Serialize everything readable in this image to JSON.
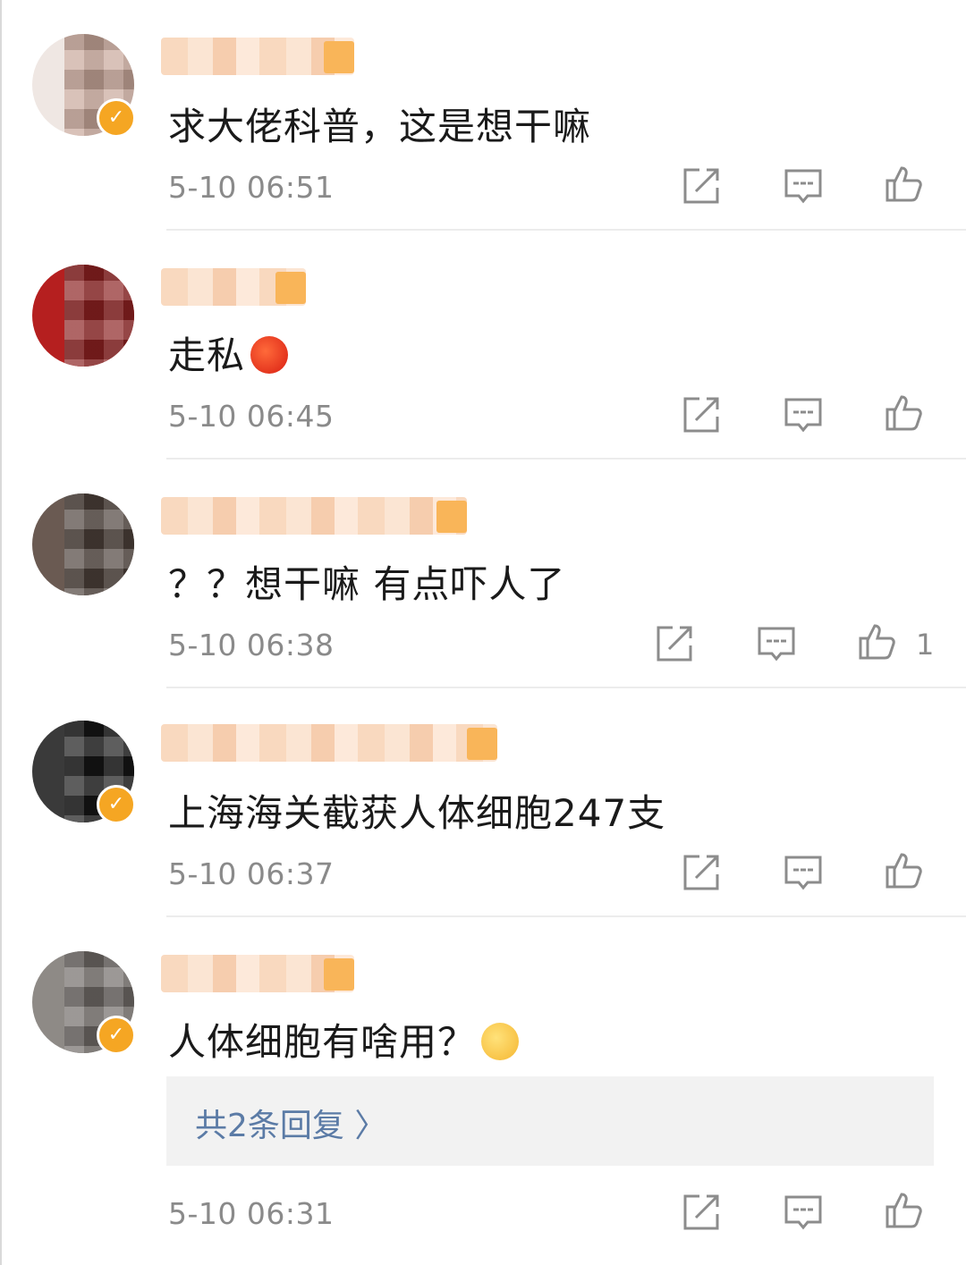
{
  "comments": [
    {
      "text": "求大佬科普，这是想干嘛",
      "time": "5-10 06:51",
      "verified": true,
      "emoji": "",
      "likes": "",
      "avatar_color": "#efe7e3"
    },
    {
      "text": "走私",
      "time": "5-10 06:45",
      "verified": false,
      "emoji": "angry-emoji",
      "likes": "",
      "avatar_color": "#b51f1f"
    },
    {
      "text": "？？想干嘛 有点吓人了",
      "time": "5-10 06:38",
      "verified": false,
      "emoji": "",
      "likes": "1",
      "avatar_color": "#6a5a52"
    },
    {
      "text": "上海海关截获人体细胞247支",
      "time": "5-10 06:37",
      "verified": true,
      "emoji": "",
      "likes": "",
      "avatar_color": "#3a3a3a"
    },
    {
      "text": "人体细胞有啥用？",
      "time": "5-10 06:31",
      "verified": true,
      "emoji": "dizzy-grin-emoji",
      "likes": "",
      "avatar_color": "#8e8a86",
      "reply_label": "共2条回复 〉"
    }
  ],
  "icons": {
    "share": "share-icon",
    "comment": "comment-icon",
    "like": "thumbs-up-icon"
  },
  "colors": {
    "verified_badge": "#f5a623",
    "reply_link": "#5b7ba6",
    "time_text": "#8a8a8a"
  }
}
